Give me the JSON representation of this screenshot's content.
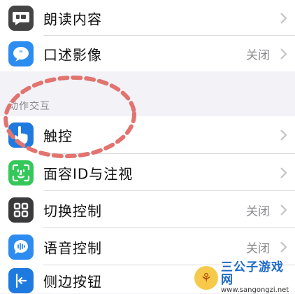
{
  "group1": [
    {
      "label": "朗读内容",
      "value": "",
      "icon": "speech-bubble-icon",
      "color": "#444444"
    },
    {
      "label": "口述影像",
      "value": "关闭",
      "icon": "quote-bubble-icon",
      "color": "#2d8cf0"
    }
  ],
  "section_header": "动作交互",
  "group2": [
    {
      "label": "触控",
      "value": "",
      "icon": "hand-pointer-icon",
      "color": "#1f7ae0"
    },
    {
      "label": "面容ID与注视",
      "value": "",
      "icon": "face-id-icon",
      "color": "#34c759"
    },
    {
      "label": "切换控制",
      "value": "关闭",
      "icon": "grid-icon",
      "color": "#3a3a3c"
    },
    {
      "label": "语音控制",
      "value": "关闭",
      "icon": "voice-control-icon",
      "color": "#2d8cf0"
    },
    {
      "label": "侧边按钮",
      "value": "",
      "icon": "side-button-icon",
      "color": "#1f7ae0"
    }
  ],
  "annotation_color": "#e2736f",
  "watermark": {
    "title": "三公子游戏网",
    "url": "www.sangongzi.net"
  }
}
